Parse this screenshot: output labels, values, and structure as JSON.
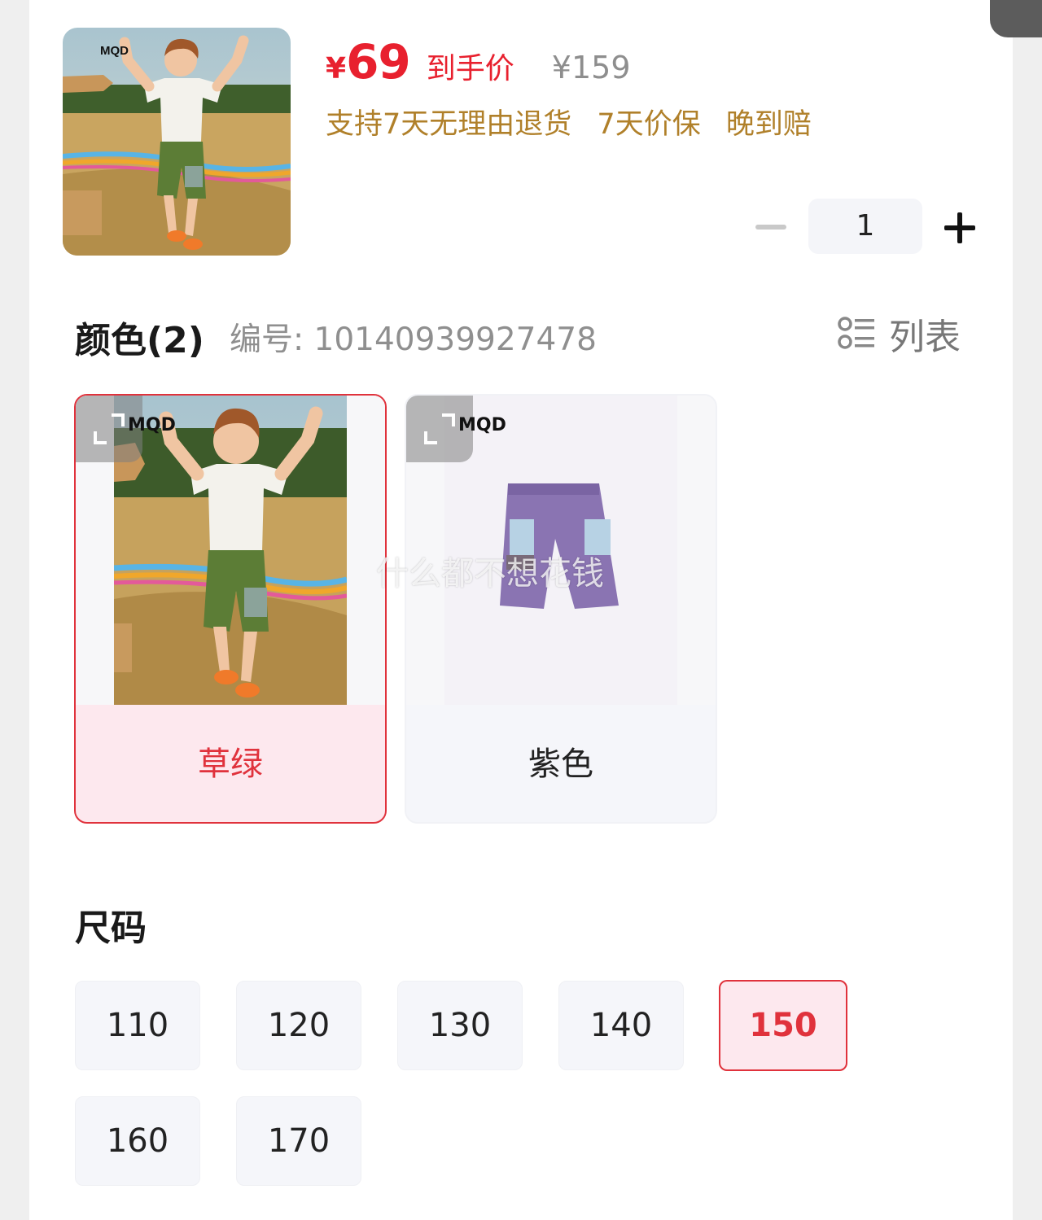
{
  "product": {
    "currency": "¥",
    "price": "69",
    "price_label": "到手价",
    "original_price": "¥159",
    "promises": [
      "支持7天无理由退货",
      "7天价保",
      "晚到赔"
    ],
    "brand": "MQD",
    "quantity": "1"
  },
  "color_section": {
    "title": "颜色(2)",
    "code": "编号: 10140939927478",
    "view_toggle_label": "列表",
    "options": [
      {
        "name": "草绿",
        "selected": true
      },
      {
        "name": "紫色",
        "selected": false
      }
    ]
  },
  "watermark": "什么都不想花钱",
  "size_section": {
    "title": "尺码",
    "options": [
      "110",
      "120",
      "130",
      "140",
      "150",
      "160",
      "170"
    ],
    "selected": "150"
  },
  "colors": {
    "accent_red": "#e8202e",
    "promise_gold": "#b0802a",
    "selected_bg": "#fde8ee",
    "chip_bg": "#f5f6fa"
  }
}
